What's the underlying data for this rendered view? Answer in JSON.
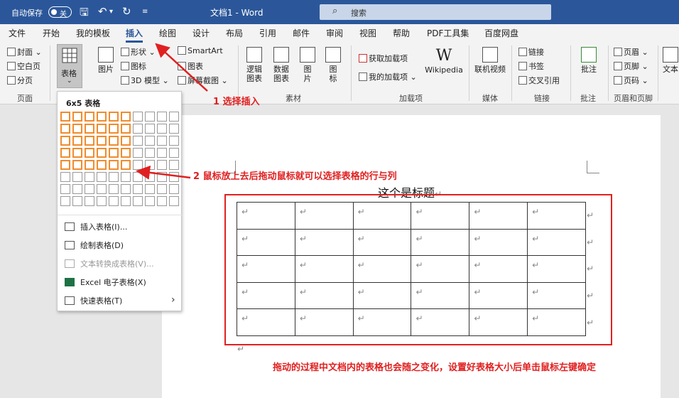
{
  "titlebar": {
    "autosave": "自动保存",
    "autosave_state": "关",
    "doc_name": "文档1 - Word",
    "search": "搜索"
  },
  "menu": [
    "文件",
    "开始",
    "我的模板",
    "插入",
    "绘图",
    "设计",
    "布局",
    "引用",
    "邮件",
    "审阅",
    "视图",
    "帮助",
    "PDF工具集",
    "百度网盘"
  ],
  "active_tab": "插入",
  "ribbon": {
    "pages": [
      "封面",
      "空白页",
      "分页"
    ],
    "pages_group": "页面",
    "table": "表格",
    "picture": "图片",
    "shapes": "形状",
    "icons": "图标",
    "model3d": "3D 模型",
    "smartart": "SmartArt",
    "chart": "图表",
    "screenshot": "屏幕截图",
    "logic_diagram": "逻辑图表",
    "data_chart": "数据图表",
    "pic": "图片",
    "gallery": "图标",
    "material_group": "素材",
    "get_addins": "获取加载项",
    "my_addins": "我的加载项",
    "wikipedia": "Wikipedia",
    "addins_group": "加载项",
    "online_video": "联机视频",
    "media_group": "媒体",
    "link": "链接",
    "bookmark": "书签",
    "crossref": "交叉引用",
    "links_group": "链接",
    "comment": "批注",
    "comment_group": "批注",
    "header": "页眉",
    "footer": "页脚",
    "page_number": "页码",
    "header_group": "页眉和页脚",
    "text": "文本"
  },
  "dropdown": {
    "title": "6x5 表格",
    "items": [
      "插入表格(I)...",
      "绘制表格(D)",
      "文本转换成表格(V)...",
      "Excel 电子表格(X)",
      "快速表格(T)"
    ]
  },
  "document": {
    "title": "这个是标题",
    "para_mark": "↵"
  },
  "annotations": {
    "step1": "1  选择插入",
    "step2": "2  鼠标放上去后拖动鼠标就可以选择表格的行与列",
    "step3": "拖动的过程中文档内的表格也会随之变化，设置好表格大小后单击鼠标左键确定"
  },
  "grid_selection": {
    "cols": 6,
    "rows": 5
  },
  "colors": {
    "accent": "#2b579a",
    "highlight": "#f08c2e",
    "annotation": "#e02020"
  }
}
